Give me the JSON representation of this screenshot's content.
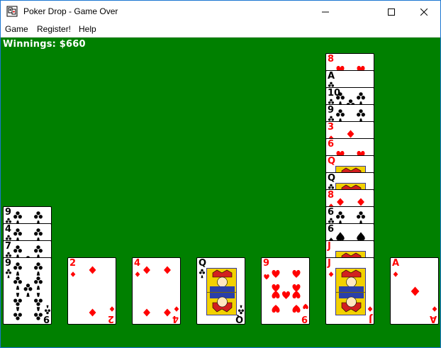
{
  "window": {
    "title": "Poker Drop - Game Over",
    "accent": "#1b76d2",
    "felt_color": "#008000"
  },
  "menu": {
    "items": [
      "Game",
      "Register!",
      "Help"
    ]
  },
  "status": {
    "winnings": "Winnings: $660"
  },
  "columns": [
    {
      "cards": [
        {
          "rank": "9",
          "suit": "clubs"
        },
        {
          "rank": "4",
          "suit": "clubs"
        },
        {
          "rank": "7",
          "suit": "clubs"
        },
        {
          "rank": "9",
          "suit": "clubs"
        }
      ]
    },
    {
      "cards": [
        {
          "rank": "2",
          "suit": "diamonds"
        }
      ]
    },
    {
      "cards": [
        {
          "rank": "4",
          "suit": "diamonds"
        }
      ]
    },
    {
      "cards": [
        {
          "rank": "Q",
          "suit": "clubs"
        }
      ]
    },
    {
      "cards": [
        {
          "rank": "9",
          "suit": "hearts"
        }
      ]
    },
    {
      "cards": [
        {
          "rank": "8",
          "suit": "hearts"
        },
        {
          "rank": "A",
          "suit": "clubs"
        },
        {
          "rank": "10",
          "suit": "clubs"
        },
        {
          "rank": "9",
          "suit": "clubs"
        },
        {
          "rank": "3",
          "suit": "diamonds"
        },
        {
          "rank": "6",
          "suit": "hearts"
        },
        {
          "rank": "Q",
          "suit": "hearts"
        },
        {
          "rank": "Q",
          "suit": "clubs"
        },
        {
          "rank": "8",
          "suit": "diamonds"
        },
        {
          "rank": "6",
          "suit": "clubs"
        },
        {
          "rank": "6",
          "suit": "spades"
        },
        {
          "rank": "J",
          "suit": "hearts"
        },
        {
          "rank": "J",
          "suit": "diamonds"
        }
      ]
    },
    {
      "cards": [
        {
          "rank": "A",
          "suit": "diamonds"
        }
      ]
    }
  ],
  "icons": {
    "app": "poker-drop-app-icon",
    "minimize": "minimize-icon",
    "maximize": "maximize-icon",
    "close": "close-icon"
  }
}
